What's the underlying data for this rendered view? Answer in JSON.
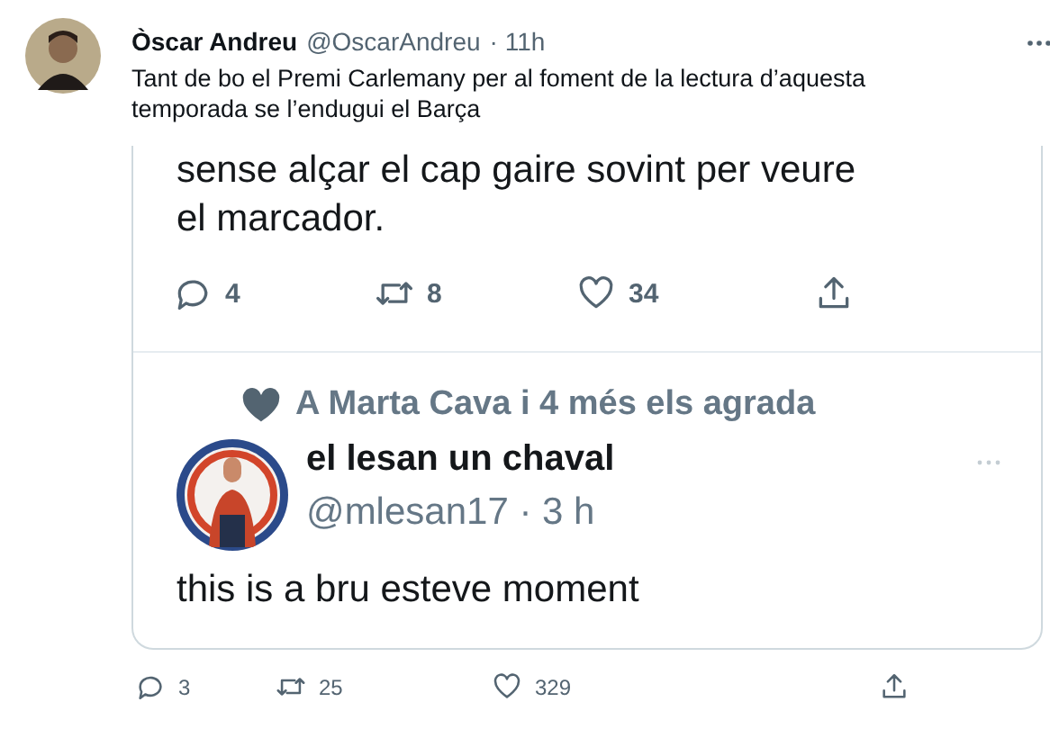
{
  "tweet": {
    "name": "Òscar Andreu",
    "handle": "@OscarAndreu",
    "time": "· 11h",
    "text": "Tant de bo el Premi Carlemany per al foment de la lectura d’aquesta temporada se l’endugui el Barça",
    "quoted_screenshot": {
      "text_lines": [
        "sense alçar el cap gaire sovint per veure",
        "el marcador."
      ],
      "actions": [
        {
          "kind": "reply",
          "count": "4"
        },
        {
          "kind": "retweet",
          "count": "8"
        },
        {
          "kind": "like",
          "count": "34"
        },
        {
          "kind": "share"
        }
      ],
      "liked_by": "A Marta Cava i 4 més els agrada",
      "reply": {
        "name": "el lesan un chaval",
        "handle": "@mlesan17",
        "time": "· 3 h",
        "text": "this is a bru esteve moment"
      }
    },
    "actions": [
      {
        "kind": "reply",
        "count": "3"
      },
      {
        "kind": "retweet",
        "count": "25"
      },
      {
        "kind": "like",
        "count": "329"
      },
      {
        "kind": "share"
      }
    ]
  }
}
